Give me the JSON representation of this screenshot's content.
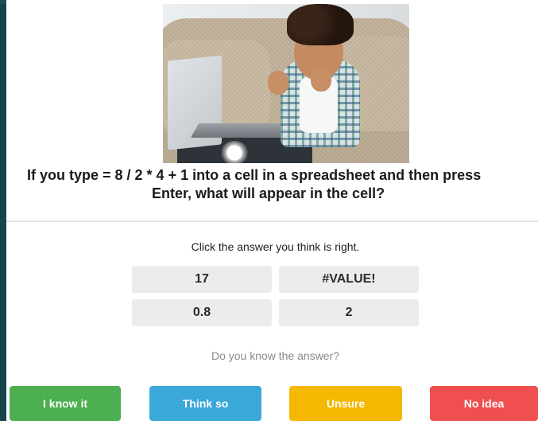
{
  "question": {
    "line1": "If you type = 8 / 2 * 4 + 1 into a cell in a spreadsheet and then press",
    "line2": "Enter, what will appear in the cell?"
  },
  "instruction": "Click the answer you think is right.",
  "answers": [
    {
      "label": "17"
    },
    {
      "label": "#VALUE!"
    },
    {
      "label": "0.8"
    },
    {
      "label": "2"
    }
  ],
  "confidence": {
    "prompt": "Do you know the answer?",
    "buttons": [
      {
        "label": "I know it",
        "color": "#4caf50"
      },
      {
        "label": "Think so",
        "color": "#3aa8d8"
      },
      {
        "label": "Unsure",
        "color": "#f5b800"
      },
      {
        "label": "No idea",
        "color": "#ef4f4f"
      }
    ]
  },
  "colors": {
    "background": "#19434a",
    "answer_bg": "#ececec"
  }
}
